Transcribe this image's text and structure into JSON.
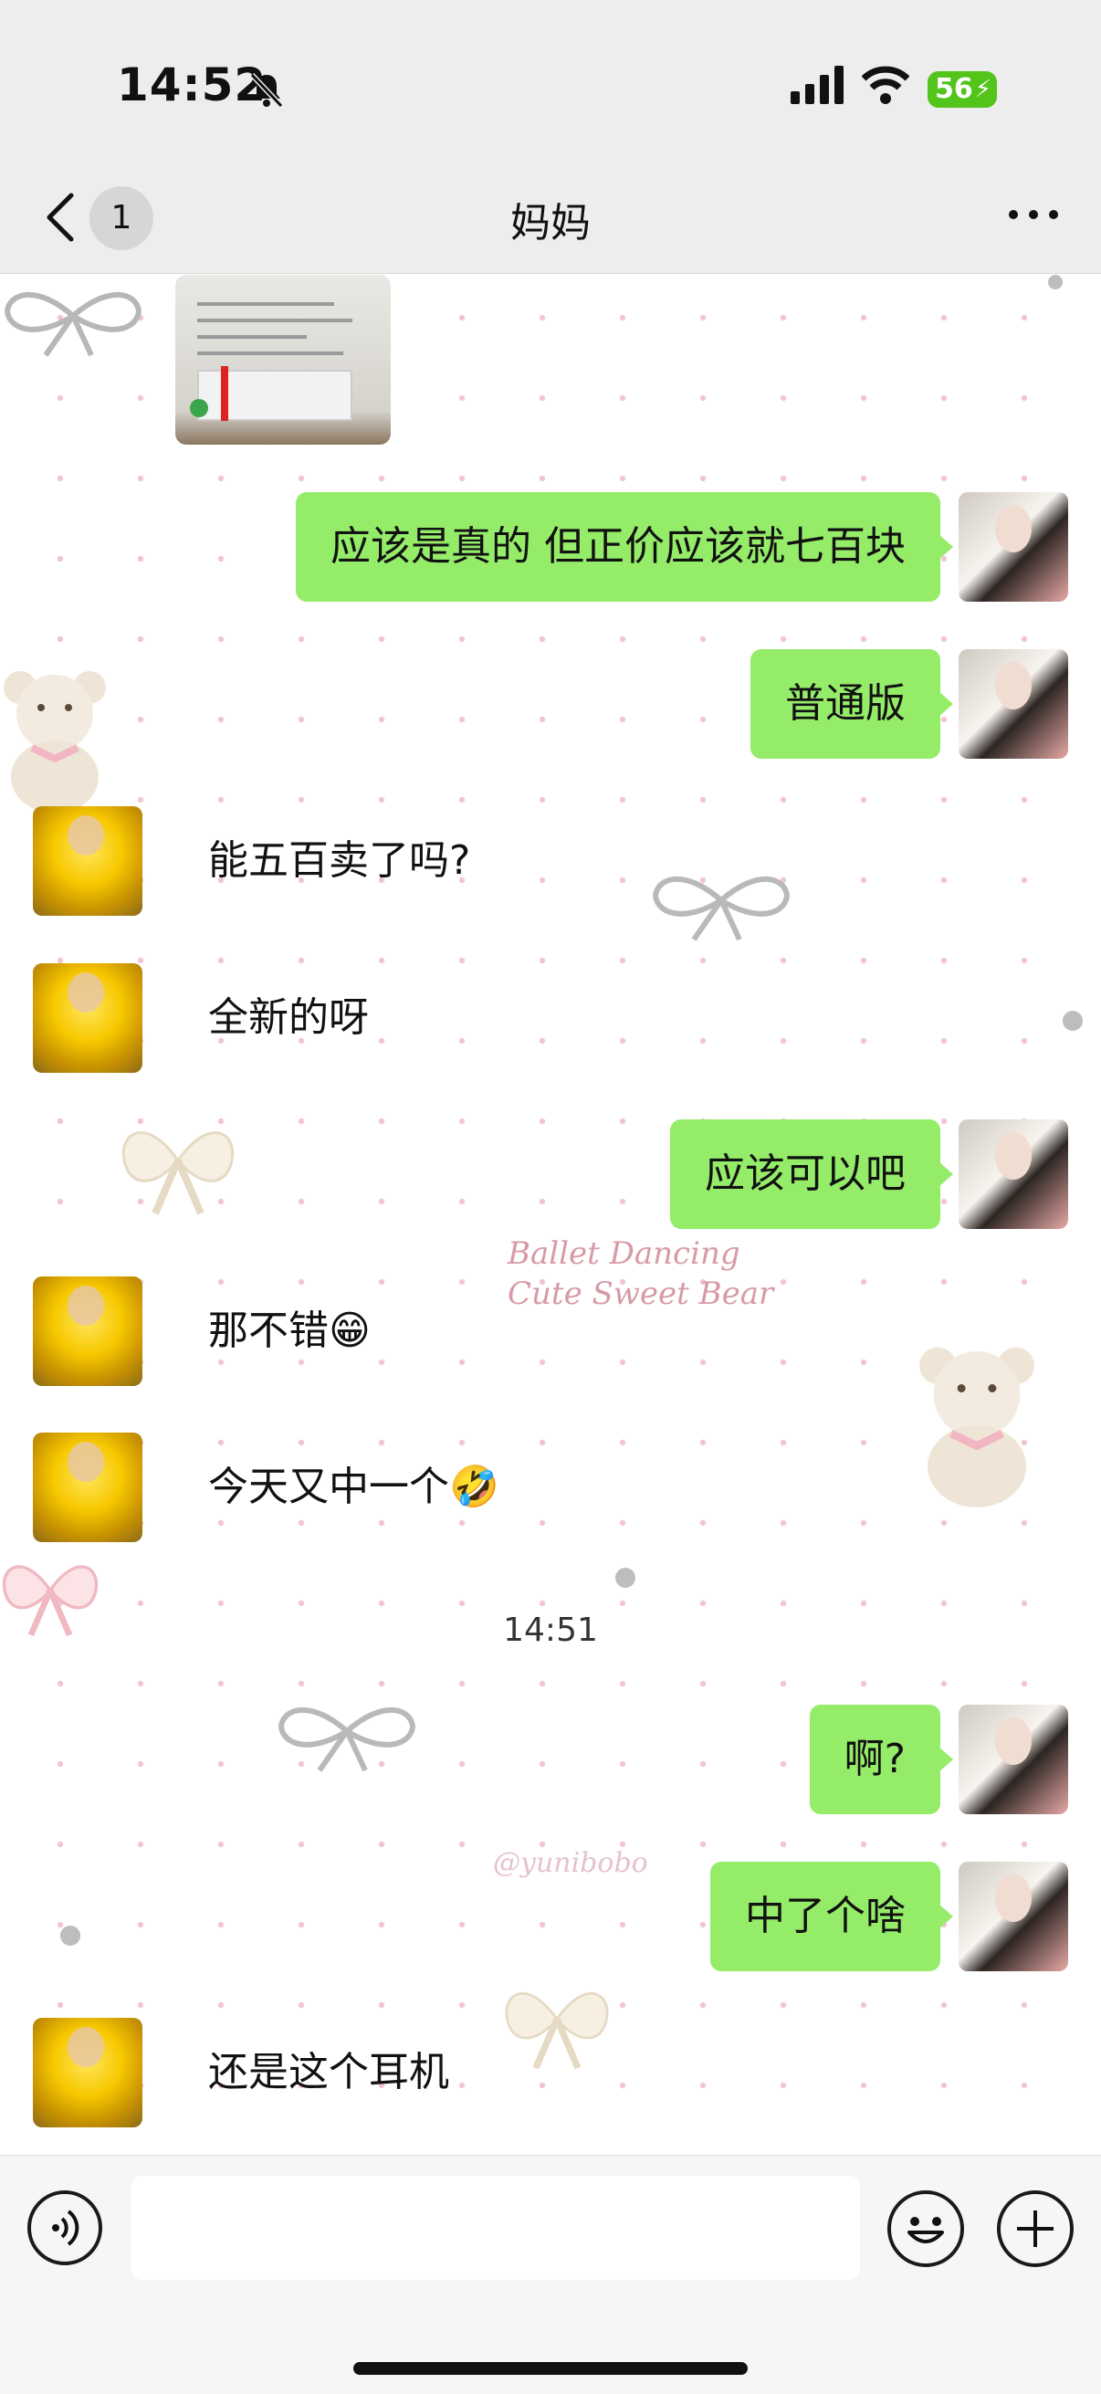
{
  "status_bar": {
    "time": "14:52",
    "battery": "56"
  },
  "nav": {
    "back_count": "1",
    "title": "妈妈"
  },
  "watermarks": {
    "line1": "Ballet Dancing",
    "line2": "Cute Sweet Bear",
    "handle": "@yunibobo"
  },
  "messages": [
    {
      "side": "left",
      "type": "image"
    },
    {
      "side": "right",
      "text": "应该是真的 但正价应该就七百块"
    },
    {
      "side": "right",
      "text": "普通版"
    },
    {
      "side": "left",
      "text": "能五百卖了吗?"
    },
    {
      "side": "left",
      "text": "全新的呀"
    },
    {
      "side": "right",
      "text": "应该可以吧"
    },
    {
      "side": "left",
      "text": "那不错😁"
    },
    {
      "side": "left",
      "text": "今天又中一个🤣"
    },
    {
      "side": "time",
      "text": "14:51"
    },
    {
      "side": "right",
      "text": "啊?"
    },
    {
      "side": "right",
      "text": "中了个啥"
    },
    {
      "side": "left",
      "text": "还是这个耳机"
    }
  ],
  "input": {
    "placeholder": ""
  },
  "icons": [
    "bell-muted-icon",
    "signal-icon",
    "wifi-icon",
    "battery-icon",
    "back-chevron-icon",
    "more-icon",
    "voice-icon",
    "emoji-icon",
    "plus-icon",
    "bow-icon",
    "teddy-bear-icon"
  ],
  "colors": {
    "bubble_right": "#95ec69",
    "header_bg": "#ededed",
    "dot_pink": "#f2c4cf",
    "battery": "#52c41a"
  }
}
